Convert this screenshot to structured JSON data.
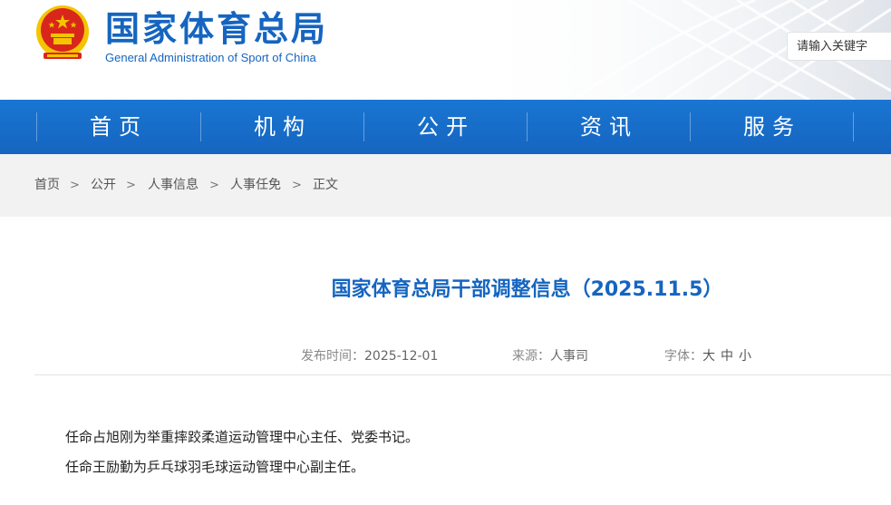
{
  "header": {
    "site_name_cn": "国家体育总局",
    "site_name_en": "General Administration of Sport of China",
    "search_placeholder": "请输入关键字"
  },
  "nav": {
    "items": [
      {
        "label": "首页"
      },
      {
        "label": "机构"
      },
      {
        "label": "公开"
      },
      {
        "label": "资讯"
      },
      {
        "label": "服务"
      }
    ]
  },
  "breadcrumb": {
    "items": [
      "首页",
      "公开",
      "人事信息",
      "人事任免",
      "正文"
    ],
    "separator": ">"
  },
  "article": {
    "title": "国家体育总局干部调整信息（2025.11.5）",
    "publish_label": "发布时间：",
    "publish_date": "2025-12-01",
    "source_label": "来源：",
    "source_value": "人事司",
    "font_label": "字体：",
    "font_sizes": [
      "大",
      "中",
      "小"
    ],
    "paragraphs": [
      "任命占旭刚为举重摔跤柔道运动管理中心主任、党委书记。",
      "任命王励勤为乒乓球羽毛球运动管理中心副主任。"
    ]
  },
  "colors": {
    "brand_blue": "#1565c0",
    "nav_blue": "#1976d2",
    "emblem_red": "#d9261c",
    "emblem_gold": "#f5c400"
  }
}
